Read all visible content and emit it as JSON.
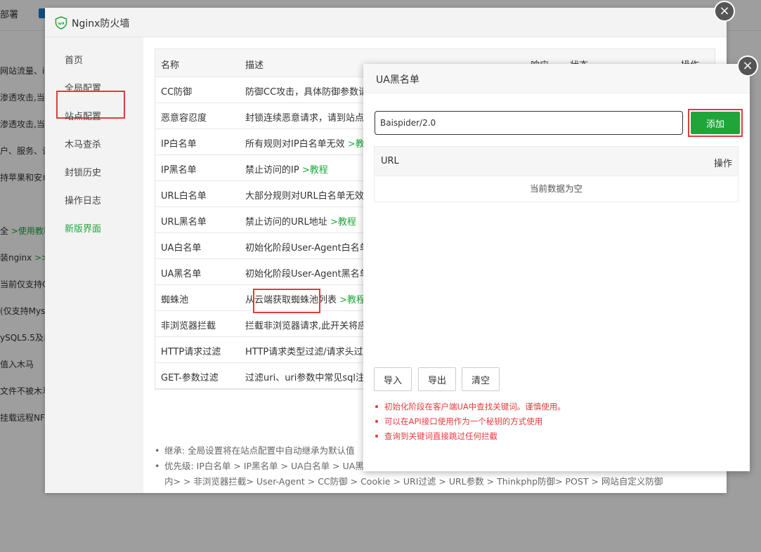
{
  "background": {
    "top_label": "部署",
    "side_lines": [
      {
        "text": "网站流量、ip"
      },
      {
        "text": "渗透攻击,当"
      },
      {
        "text": "渗透攻击,当"
      },
      {
        "text": "户、服务、计"
      },
      {
        "text": "持苹果和安卓"
      },
      {
        "text": "全 ",
        "link": ">使用教程"
      },
      {
        "text": "装nginx ",
        "link": ">>"
      },
      {
        "text": "当前仅支持C"
      },
      {
        "text": "(仅支持Mys"
      },
      {
        "text": "ySQL5.5及以"
      },
      {
        "text": "值入木马"
      },
      {
        "text": "文件不被木马"
      },
      {
        "text": "挂载远程NFS"
      }
    ]
  },
  "firewall": {
    "title": "Nginx防火墙",
    "close_icon": "×",
    "nav": [
      "首页",
      "全局配置",
      "站点配置",
      "木马查杀",
      "封锁历史",
      "操作日志",
      "新版界面"
    ],
    "table": {
      "headers": {
        "name": "名称",
        "desc": "描述",
        "response": "响应",
        "status": "状态",
        "op": "操作"
      },
      "rows": [
        {
          "name": "CC防御",
          "desc": "防御CC攻击，具体防御参数请",
          "link": ""
        },
        {
          "name": "恶意容忍度",
          "desc": "封锁连续恶意请求，请到站点",
          "link": ""
        },
        {
          "name": "IP白名单",
          "desc": "所有规则对IP白名单无效 ",
          "link": ">教"
        },
        {
          "name": "IP黑名单",
          "desc": "禁止访问的IP ",
          "link": ">教程"
        },
        {
          "name": "URL白名单",
          "desc": "大部分规则对URL白名单无效",
          "link": ""
        },
        {
          "name": "URL黑名单",
          "desc": "禁止访问的URL地址 ",
          "link": ">教程"
        },
        {
          "name": "UA白名单",
          "desc": "初始化阶段User-Agent白名单",
          "link": ""
        },
        {
          "name": "UA黑名单",
          "desc": "初始化阶段User-Agent黑名单",
          "link": ""
        },
        {
          "name": "蜘蛛池",
          "desc": "从云端获取蜘蛛池列表 ",
          "link": ">教程"
        },
        {
          "name": "非浏览器拦截",
          "desc": "拦截非浏览器请求,此开关将应",
          "link": ""
        },
        {
          "name": "HTTP请求过滤",
          "desc": "HTTP请求类型过滤/请求头过",
          "link": ""
        },
        {
          "name": "GET-参数过滤",
          "desc": "过滤uri、uri参数中常见sql注",
          "link": ""
        }
      ]
    },
    "notes": [
      "继承: 全局设置将在站点配置中自动继承为默认值",
      "优先级: IP白名单 > IP黑名单 > UA白名单 > UA黑",
      "内> > 非浏览器拦截> User-Agent > CC防御 > Cookie > URI过滤 > URL参数 > Thinkphp防御> POST > 网站自定义防御"
    ]
  },
  "ua_modal": {
    "title": "UA黑名单",
    "close_icon": "×",
    "input_value": "Baispider/2.0",
    "add_label": "添加",
    "table_headers": {
      "url": "URL",
      "op": "操作"
    },
    "empty_text": "当前数据为空",
    "import_label": "导入",
    "export_label": "导出",
    "clear_label": "清空",
    "tips": [
      "初始化阶段在客户端UA中查找关键词。谨慎使用。",
      "可以在API接口使用作为一个秘钥的方式使用",
      "查询到关键词直接跳过任何拦截"
    ]
  }
}
